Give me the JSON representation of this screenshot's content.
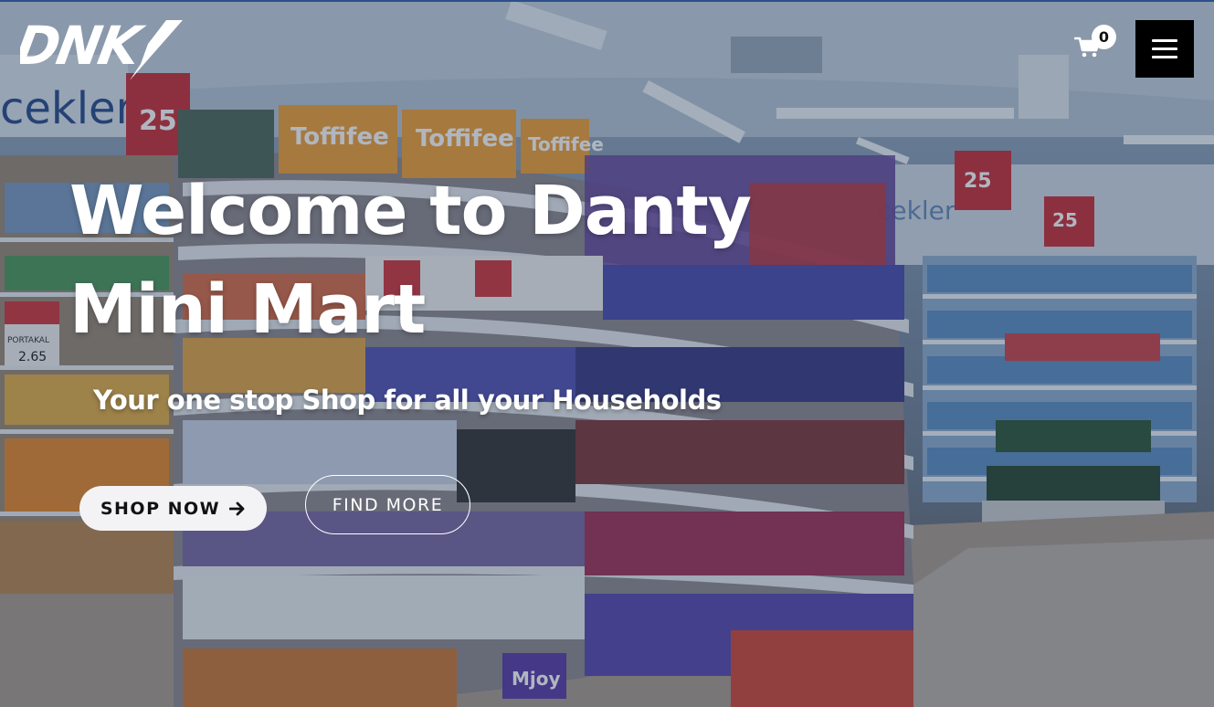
{
  "brand": {
    "logo_text": "DNK"
  },
  "header": {
    "cart_count": "0",
    "cart_icon": "shopping-cart-icon",
    "menu_icon": "hamburger-menu-icon"
  },
  "hero": {
    "title_line1": "Welcome to Danty",
    "title_line2": "Mini Mart",
    "subtitle": "Your one stop Shop for all your Households",
    "shop_button_label": "SHOP NOW",
    "shop_button_icon": "arrow-right-icon",
    "find_button_label": "FIND MORE"
  },
  "background": {
    "signs": [
      "cekler",
      "Toffifee",
      "Toffifee",
      "Toffifee",
      "25",
      "25",
      "PORTAKAL",
      "2.65",
      "cekler",
      "Mjoy"
    ]
  },
  "colors": {
    "overlay": "#1e2d4b",
    "menu_button": "#000000",
    "primary_button": "#f3f3f5",
    "text": "#ffffff"
  }
}
